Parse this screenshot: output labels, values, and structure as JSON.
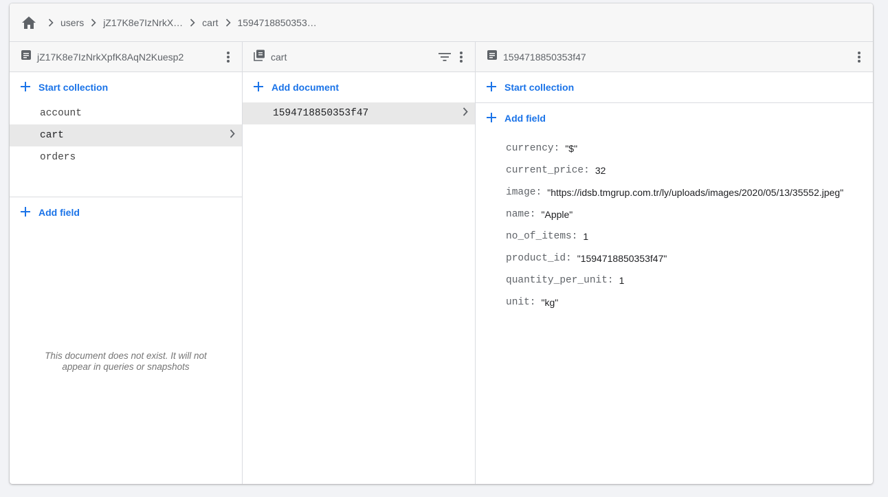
{
  "breadcrumb": {
    "items": [
      "users",
      "jZ17K8e7IzNrkX…",
      "cart",
      "1594718850353…"
    ]
  },
  "panel1": {
    "title": "jZ17K8e7IzNrkXpfK8AqN2Kuesp2",
    "start_collection": "Start collection",
    "collections": [
      "account",
      "cart",
      "orders"
    ],
    "selected": "cart",
    "add_field": "Add field",
    "empty_note": "This document does not exist. It will not appear in queries or snapshots"
  },
  "panel2": {
    "title": "cart",
    "add_document": "Add document",
    "documents": [
      "1594718850353f47"
    ]
  },
  "panel3": {
    "title": "1594718850353f47",
    "start_collection": "Start collection",
    "add_field": "Add field",
    "fields": [
      {
        "key": "currency:",
        "value": "\"$\""
      },
      {
        "key": "current_price:",
        "value": "32"
      },
      {
        "key": "image:",
        "value": "\"https://idsb.tmgrup.com.tr/ly/uploads/images/2020/05/13/35552.jpeg\""
      },
      {
        "key": "name:",
        "value": "\"Apple\""
      },
      {
        "key": "no_of_items:",
        "value": "1"
      },
      {
        "key": "product_id:",
        "value": "\"1594718850353f47\""
      },
      {
        "key": "quantity_per_unit:",
        "value": "1"
      },
      {
        "key": "unit:",
        "value": "\"kg\""
      }
    ]
  },
  "colors": {
    "accent": "#1a73e8",
    "header_bg": "#f7f7f7",
    "selected_row": "#e8e8e8",
    "page_bg": "#f2f3f6"
  }
}
